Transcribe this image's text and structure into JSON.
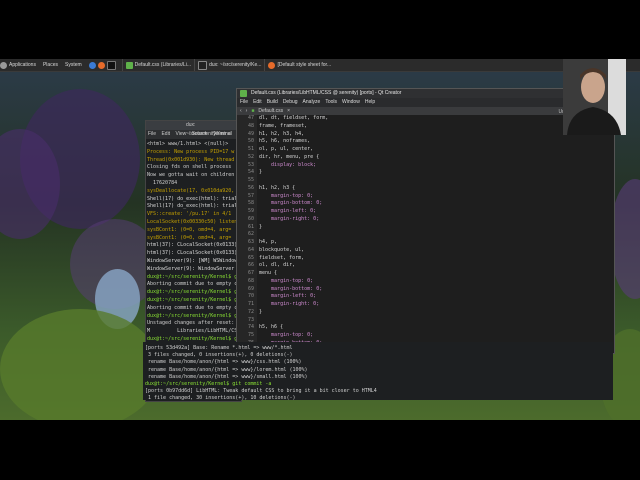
{
  "taskbar": {
    "menus": [
      "Applications",
      "Places",
      "System"
    ],
    "windows": [
      "Default.css (Libraries/Li...",
      "dux: ~/src/serenity/Ke...",
      "[Default style sheet for..."
    ]
  },
  "back_terminal": {
    "title": "dux: ~/src/serenity/Kernel",
    "menu": [
      "File",
      "Edit",
      "View",
      "Search",
      "Terminal"
    ],
    "lines": [
      "<html> www/1.html> <(null)>",
      "Process: New process PID=17 w",
      "Thread(0x001d930): New thread",
      "Closing fds on shell process",
      "Now we gotta wait on children",
      "  17620784",
      "sysDeallocate(17, 0x010da920, ",
      "Shell(17) do_exec(html): trial",
      "Shell(17) do_exec(html): trial",
      "VFS::create: '/pu.17' in 4/1",
      "LocalSocket(0x00330c50) listen",
      "sysBCont1: (0=0, omd=4, arg=",
      "sysBCont1: (0=0, omd=4, arg=",
      "html(37): CLocalSocket(0x0133)",
      "html(37): CLocalSocket(0x0133)",
      "WindowServer(9): [WM] WSWindow",
      "WindowServer(9): WindowServer",
      "dux@t:~/src/serenity/Kernel$ g",
      "Aborting commit due to empty c",
      "dux@t:~/src/serenity/Kernel$ g",
      "dux@t:~/src/serenity/Kernel$ gi",
      "Aborting commit due to empty c",
      "dux@t:~/src/serenity/Kernel$ g",
      "Unstaged changes after reset:",
      "M         Libraries/LibHTML/CSS/",
      "dux@t:~/src/serenity/Kernel$ gi"
    ]
  },
  "qt": {
    "title": "Default.css (Libraries/LibHTML/CSS @ serenity) [ports] - Qt Creator",
    "menu": [
      "File",
      "Edit",
      "Build",
      "Debug",
      "Analyze",
      "Tools",
      "Window",
      "Help"
    ],
    "tab": "Default.css",
    "unix_label": "Uni",
    "line_numbers": [
      "47",
      "48",
      "49",
      "50",
      "51",
      "52",
      "53",
      "54",
      "55",
      "56",
      "57",
      "58",
      "59",
      "60",
      "61",
      "62",
      "63",
      "64",
      "65",
      "66",
      "67",
      "68",
      "69",
      "70",
      "71",
      "72",
      "73",
      "74",
      "75",
      "76",
      "77",
      "78",
      "79"
    ],
    "code": [
      "dl, dt, fieldset, form,",
      "frame, frameset,",
      "h1, h2, h3, h4,",
      "h5, h6, noframes,",
      "ol, p, ul, center,",
      "dir, hr, menu, pre {",
      "    display: block;",
      "}",
      "",
      "h1, h2, h3 {",
      "    margin-top: 0;",
      "    margin-bottom: 0;",
      "    margin-left: 0;",
      "    margin-right: 0;",
      "}",
      "",
      "h4, p,",
      "blockquote, ul,",
      "fieldset, form,",
      "ol, dl, dir,",
      "menu {",
      "    margin-top: 0;",
      "    margin-bottom: 0;",
      "    margin-left: 0;",
      "    margin-right: 0;",
      "}",
      "",
      "h5, h6 {",
      "    margin-top: 0;",
      "    margin-bottom: 0;",
      "    margin-left: 0;",
      "    margin-right: 0;",
      ""
    ],
    "status": [
      "default",
      "1 Issues",
      "2 Search ...",
      "3 Applica...",
      "4 Compil...",
      "5 QML De...",
      "6 Genera...",
      "7 Version...",
      "8 Test Re..."
    ]
  },
  "main_terminal": {
    "lines": [
      "[ports 53d492a] Base: Rename *.html => www/*.html",
      " 3 files changed, 0 insertions(+), 0 deletions(-)",
      " rename Base/home/anon/{html => www}/css.html (100%)",
      " rename Base/home/anon/{html => www}/lorem.html (100%)",
      " rename Base/home/anon/{html => www}/small.html (100%)",
      "dux@t:~/src/serenity/Kernel$ git commit -a",
      "[ports 0b97dd6d] LibHTML: Tweak default CSS to bring it a bit closer to HTML4",
      " 1 file changed, 30 insertions(+), 10 deletions(-)",
      "dux@t:~/src/serenity/Kernel$ "
    ]
  },
  "colors": {
    "prompt": "#8ae234",
    "accent": "#5fb14a",
    "property": "#d08cd1",
    "value": "#d6c36c"
  }
}
